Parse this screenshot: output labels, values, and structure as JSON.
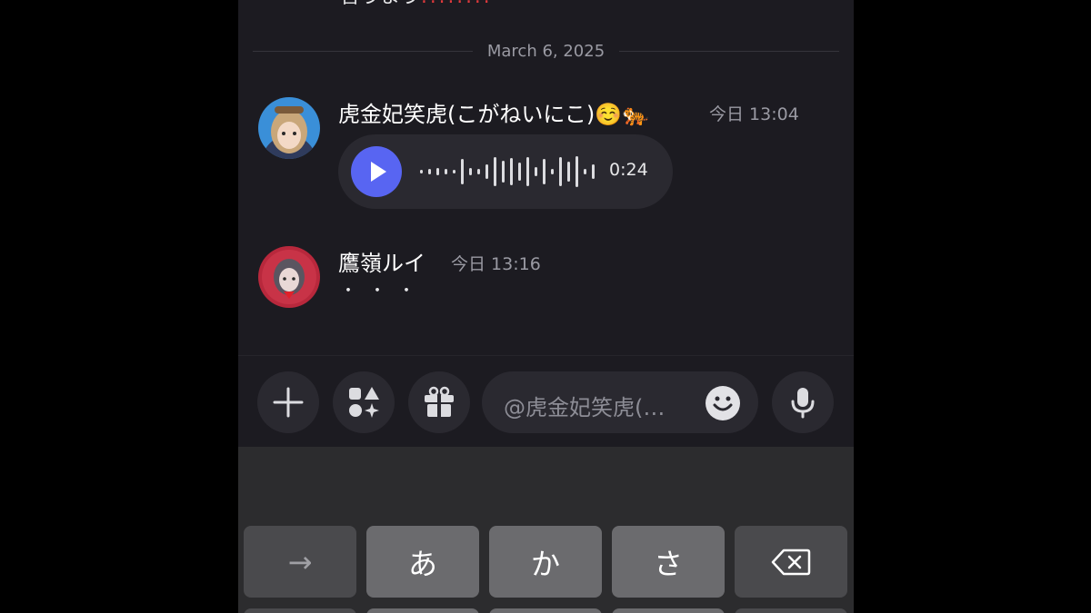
{
  "chat": {
    "prev_message_text": "言うまう",
    "prev_message_trail": "!!!!!!!!",
    "date_divider": "March 6, 2025",
    "messages": [
      {
        "author": "虎金妃笑虎(こがねいにこ)☺️🐅",
        "timestamp": "今日 13:04",
        "voice_duration": "0:24"
      },
      {
        "author": "鷹嶺ルイ",
        "timestamp": "今日 13:16",
        "content": "・・・"
      }
    ]
  },
  "composer": {
    "placeholder": "@虎金妃笑虎(…",
    "buttons": [
      "plus-icon",
      "apps-icon",
      "gift-icon",
      "emoji-icon",
      "microphone-icon"
    ]
  },
  "keyboard": {
    "keys": [
      "→",
      "あ",
      "か",
      "さ",
      "⌫"
    ]
  },
  "colors": {
    "background": "#1c1b21",
    "accent": "#5865f2",
    "surface": "#2a2930"
  }
}
